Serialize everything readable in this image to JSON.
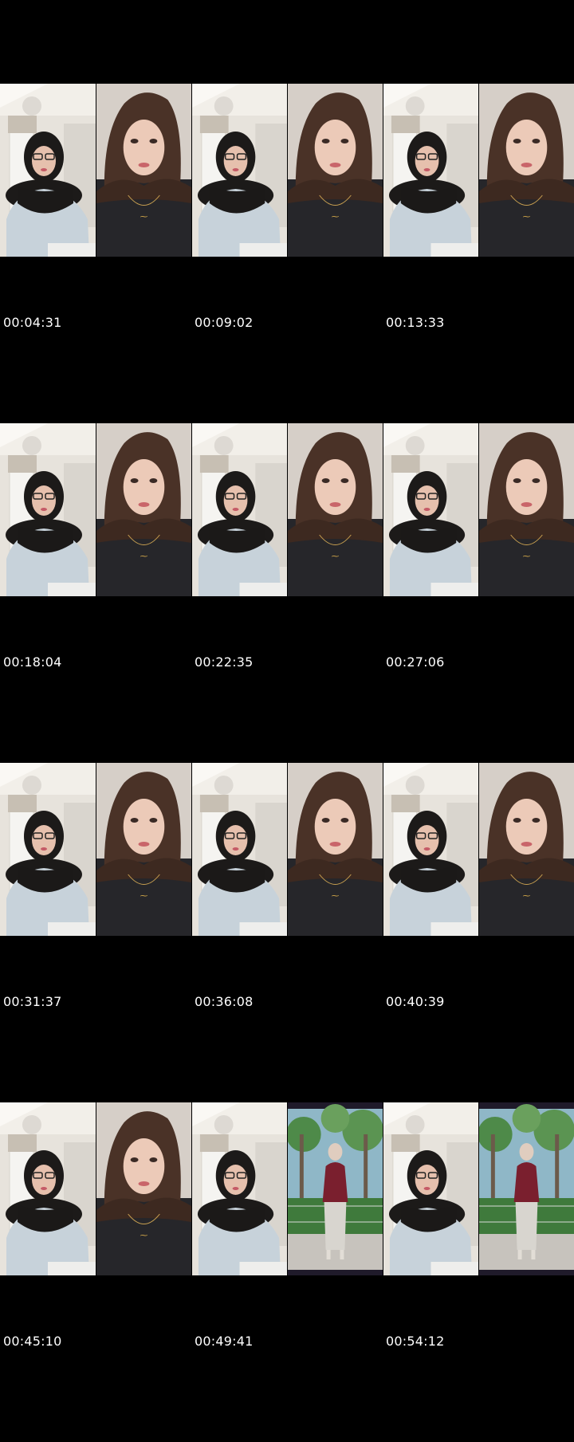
{
  "rows": [
    {
      "frames": [
        "room-glasses",
        "closeup-necklace",
        "room-glasses",
        "closeup-necklace",
        "room-glasses",
        "closeup-necklace"
      ],
      "timestamps": [
        "00:04:31",
        "00:09:02",
        "00:13:33"
      ]
    },
    {
      "frames": [
        "room-glasses",
        "closeup-necklace",
        "room-glasses",
        "closeup-necklace",
        "room-glasses",
        "closeup-necklace"
      ],
      "timestamps": [
        "00:18:04",
        "00:22:35",
        "00:27:06"
      ]
    },
    {
      "frames": [
        "room-glasses",
        "closeup-necklace",
        "room-glasses",
        "closeup-necklace",
        "room-glasses",
        "closeup-necklace"
      ],
      "timestamps": [
        "00:31:37",
        "00:36:08",
        "00:40:39"
      ]
    },
    {
      "frames": [
        "room-glasses",
        "closeup-necklace",
        "room-glasses",
        "outdoor-fullbody",
        "room-glasses",
        "outdoor-fullbody"
      ],
      "timestamps": [
        "00:45:10",
        "00:49:41",
        "00:54:12"
      ]
    }
  ],
  "colors": {
    "background": "#000000",
    "timestamp_text": "#ffffff"
  }
}
